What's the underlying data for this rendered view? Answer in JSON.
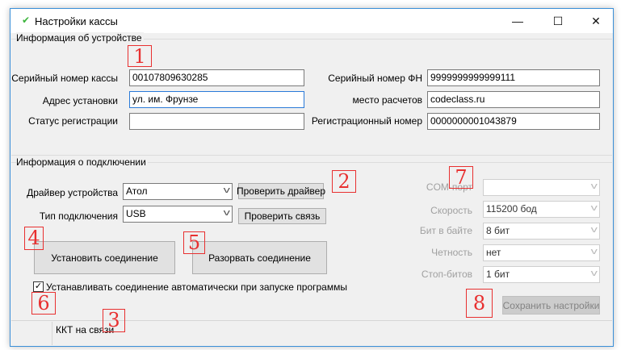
{
  "window": {
    "title": "Настройки кассы",
    "icon": "check-icon",
    "controls": {
      "minimize": "—",
      "maximize": "☐",
      "close": "✕"
    }
  },
  "device": {
    "group_label": "Информация об устройстве",
    "serial_label": "Серийный номер кассы",
    "serial_value": "00107809630285",
    "address_label": "Адрес установки",
    "address_value": "ул. им. Фрунзе",
    "reg_status_label": "Статус регистрации",
    "reg_status_value": "",
    "fn_serial_label": "Серийный номер ФН",
    "fn_serial_value": "9999999999999111",
    "place_label": "место расчетов",
    "place_value": "codeclass.ru",
    "reg_number_label": "Регистрационный номер",
    "reg_number_value": "0000000001043879"
  },
  "connection": {
    "group_label": "Информация о подключении",
    "driver_label": "Драйвер устройства",
    "driver_value": "Атол",
    "check_driver": "Проверить драйвер",
    "type_label": "Тип подключения",
    "type_value": "USB",
    "check_link": "Проверить связь",
    "connect": "Установить соединение",
    "disconnect": "Разорвать соединение",
    "auto_connect_label": "Устанавливать соединение автоматически при запуске программы",
    "auto_connect_checked": true,
    "com_label": "COM-порт",
    "com_value": "",
    "speed_label": "Скорость",
    "speed_value": "115200 бод",
    "bits_label": "Бит в байте",
    "bits_value": "8 бит",
    "parity_label": "Четность",
    "parity_value": "нет",
    "stop_label": "Стоп-битов",
    "stop_value": "1 бит",
    "save": "Сохранить настройки"
  },
  "status_bar": {
    "text": "ККТ на связи"
  },
  "annotations": [
    "1",
    "2",
    "3",
    "4",
    "5",
    "6",
    "7",
    "8"
  ],
  "colors": {
    "annotation": "#e83030",
    "focus_border": "#2a7ad8",
    "window_border": "#3a8fd8"
  }
}
